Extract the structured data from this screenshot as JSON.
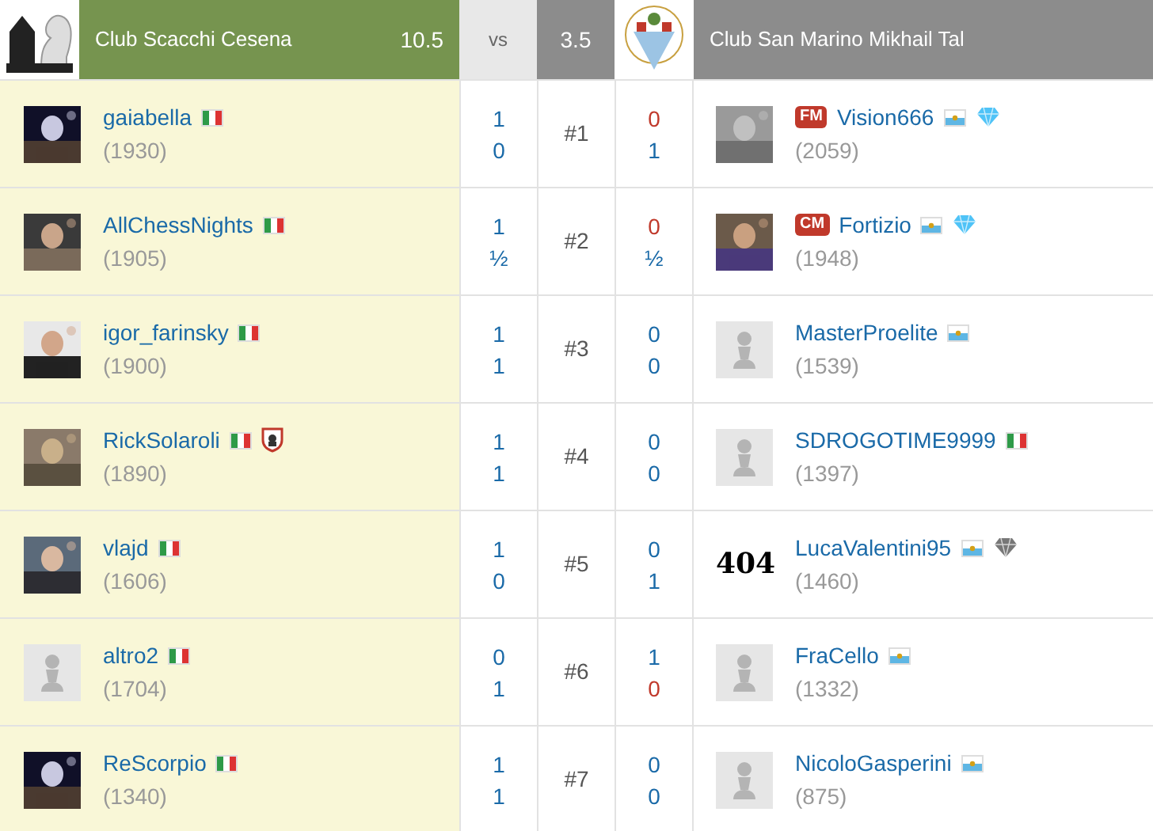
{
  "header": {
    "home": {
      "name": "Club Scacchi Cesena",
      "score": "10.5"
    },
    "vs": "vs",
    "away": {
      "name": "Club San Marino Mikhail Tal",
      "score": "3.5"
    }
  },
  "boards": [
    {
      "board": "#1",
      "left": {
        "name": "gaiabella",
        "flag": {
          "kind": "italy"
        },
        "rating": "(1930)"
      },
      "left_scores": [
        {
          "value": "1",
          "color": "#1a6aa8"
        },
        {
          "value": "0",
          "color": "#1a6aa8"
        }
      ],
      "right_scores": [
        {
          "value": "0",
          "color": "#c0392b"
        },
        {
          "value": "1",
          "color": "#1a6aa8"
        }
      ],
      "right": {
        "title": "FM",
        "name": "Vision666",
        "flag": {
          "kind": "san-marino"
        },
        "rating": "(2059)",
        "extras": [
          {
            "kind": "diamond",
            "color": "#4fc3f7"
          }
        ]
      }
    },
    {
      "board": "#2",
      "left": {
        "name": "AllChessNights",
        "flag": {
          "kind": "italy"
        },
        "rating": "(1905)"
      },
      "left_scores": [
        {
          "value": "1",
          "color": "#1a6aa8"
        },
        {
          "value": "½",
          "color": "#1a6aa8"
        }
      ],
      "right_scores": [
        {
          "value": "0",
          "color": "#c0392b"
        },
        {
          "value": "½",
          "color": "#1a6aa8"
        }
      ],
      "right": {
        "title": "CM",
        "name": "Fortizio",
        "flag": {
          "kind": "san-marino"
        },
        "rating": "(1948)",
        "extras": [
          {
            "kind": "diamond",
            "color": "#4fc3f7"
          }
        ]
      }
    },
    {
      "board": "#3",
      "left": {
        "name": "igor_farinsky",
        "flag": {
          "kind": "italy"
        },
        "rating": "(1900)"
      },
      "left_scores": [
        {
          "value": "1",
          "color": "#1a6aa8"
        },
        {
          "value": "1",
          "color": "#1a6aa8"
        }
      ],
      "right_scores": [
        {
          "value": "0",
          "color": "#1a6aa8"
        },
        {
          "value": "0",
          "color": "#1a6aa8"
        }
      ],
      "right": {
        "avatar": {
          "kind": "pawn"
        },
        "name": "MasterProelite",
        "flag": {
          "kind": "san-marino"
        },
        "rating": "(1539)"
      }
    },
    {
      "board": "#4",
      "left": {
        "name": "RickSolaroli",
        "flag": {
          "kind": "italy"
        },
        "rating": "(1890)",
        "extras": [
          {
            "kind": "shield"
          }
        ]
      },
      "left_scores": [
        {
          "value": "1",
          "color": "#1a6aa8"
        },
        {
          "value": "1",
          "color": "#1a6aa8"
        }
      ],
      "right_scores": [
        {
          "value": "0",
          "color": "#1a6aa8"
        },
        {
          "value": "0",
          "color": "#1a6aa8"
        }
      ],
      "right": {
        "avatar": {
          "kind": "pawn"
        },
        "name": "SDROGOTIME9999",
        "flag": {
          "kind": "italy"
        },
        "rating": "(1397)"
      }
    },
    {
      "board": "#5",
      "left": {
        "name": "vlajd",
        "flag": {
          "kind": "italy"
        },
        "rating": "(1606)"
      },
      "left_scores": [
        {
          "value": "1",
          "color": "#1a6aa8"
        },
        {
          "value": "0",
          "color": "#1a6aa8"
        }
      ],
      "right_scores": [
        {
          "value": "0",
          "color": "#1a6aa8"
        },
        {
          "value": "1",
          "color": "#1a6aa8"
        }
      ],
      "right": {
        "avatar": {
          "kind": "text",
          "text": "404"
        },
        "name": "LucaValentini95",
        "flag": {
          "kind": "san-marino"
        },
        "rating": "(1460)",
        "extras": [
          {
            "kind": "diamond",
            "color": "#777777"
          }
        ]
      }
    },
    {
      "board": "#6",
      "left": {
        "avatar": {
          "kind": "pawn"
        },
        "name": "altro2",
        "flag": {
          "kind": "italy"
        },
        "rating": "(1704)"
      },
      "left_scores": [
        {
          "value": "0",
          "color": "#1a6aa8"
        },
        {
          "value": "1",
          "color": "#1a6aa8"
        }
      ],
      "right_scores": [
        {
          "value": "1",
          "color": "#1a6aa8"
        },
        {
          "value": "0",
          "color": "#c0392b"
        }
      ],
      "right": {
        "avatar": {
          "kind": "pawn"
        },
        "name": "FraCello",
        "flag": {
          "kind": "san-marino"
        },
        "rating": "(1332)"
      }
    },
    {
      "board": "#7",
      "left": {
        "name": "ReScorpio",
        "flag": {
          "kind": "italy"
        },
        "rating": "(1340)"
      },
      "left_scores": [
        {
          "value": "1",
          "color": "#1a6aa8"
        },
        {
          "value": "1",
          "color": "#1a6aa8"
        }
      ],
      "right_scores": [
        {
          "value": "0",
          "color": "#1a6aa8"
        },
        {
          "value": "0",
          "color": "#1a6aa8"
        }
      ],
      "right": {
        "avatar": {
          "kind": "pawn"
        },
        "name": "NicoloGasperini",
        "flag": {
          "kind": "san-marino"
        },
        "rating": "(875)"
      }
    }
  ]
}
